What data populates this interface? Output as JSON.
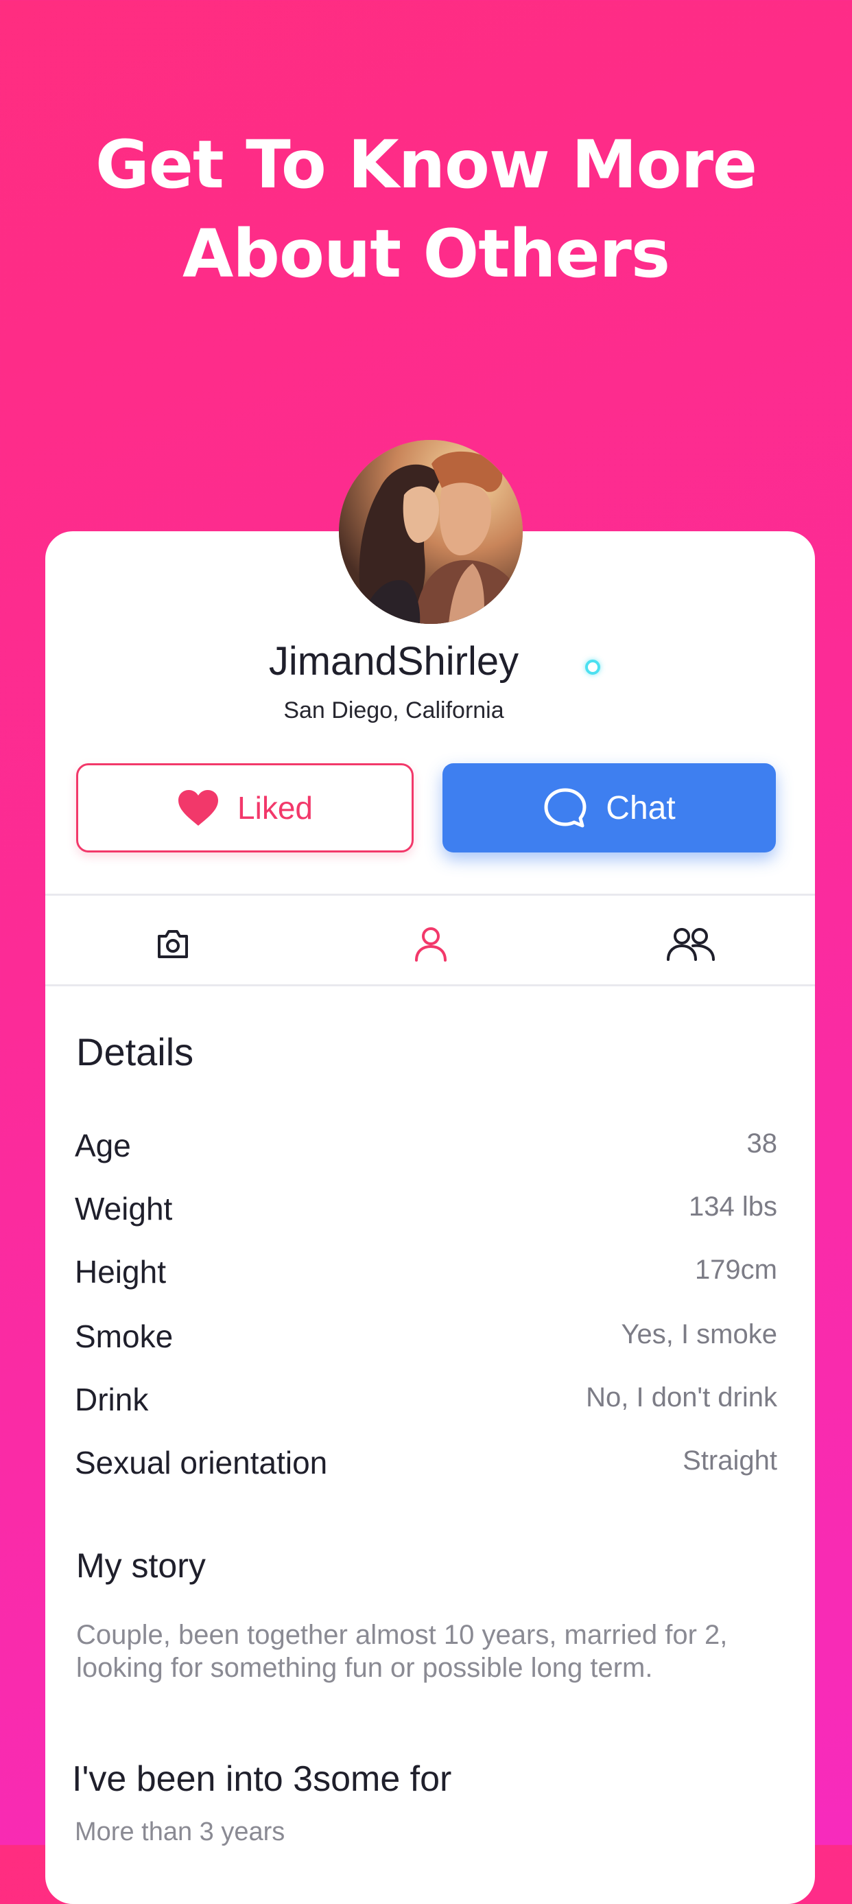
{
  "headline": {
    "line1": "Get To Know More",
    "line2": "About Others"
  },
  "profile": {
    "name": "JimandShirley",
    "location": "San Diego, California",
    "online": true
  },
  "actions": {
    "liked_label": "Liked",
    "chat_label": "Chat"
  },
  "tabs": [
    {
      "icon": "camera-icon",
      "active": false
    },
    {
      "icon": "person-icon",
      "active": true
    },
    {
      "icon": "group-icon",
      "active": false
    }
  ],
  "details": {
    "title": "Details",
    "rows": [
      {
        "label": "Age",
        "value": "38"
      },
      {
        "label": "Weight",
        "value": "134 lbs"
      },
      {
        "label": "Height",
        "value": "179cm"
      },
      {
        "label": "Smoke",
        "value": "Yes, I smoke"
      },
      {
        "label": "Drink",
        "value": "No, I don't drink"
      },
      {
        "label": "Sexual orientation",
        "value": "Straight"
      }
    ]
  },
  "story": {
    "title": "My story",
    "text": "Couple, been together almost 10 years, married for 2, looking for something fun or possible long term."
  },
  "experience": {
    "question": "I've been into 3some for",
    "answer": "More than 3 years"
  },
  "colors": {
    "accent": "#f2386a",
    "chat": "#3e7ff0",
    "online": "#4be0f0"
  }
}
